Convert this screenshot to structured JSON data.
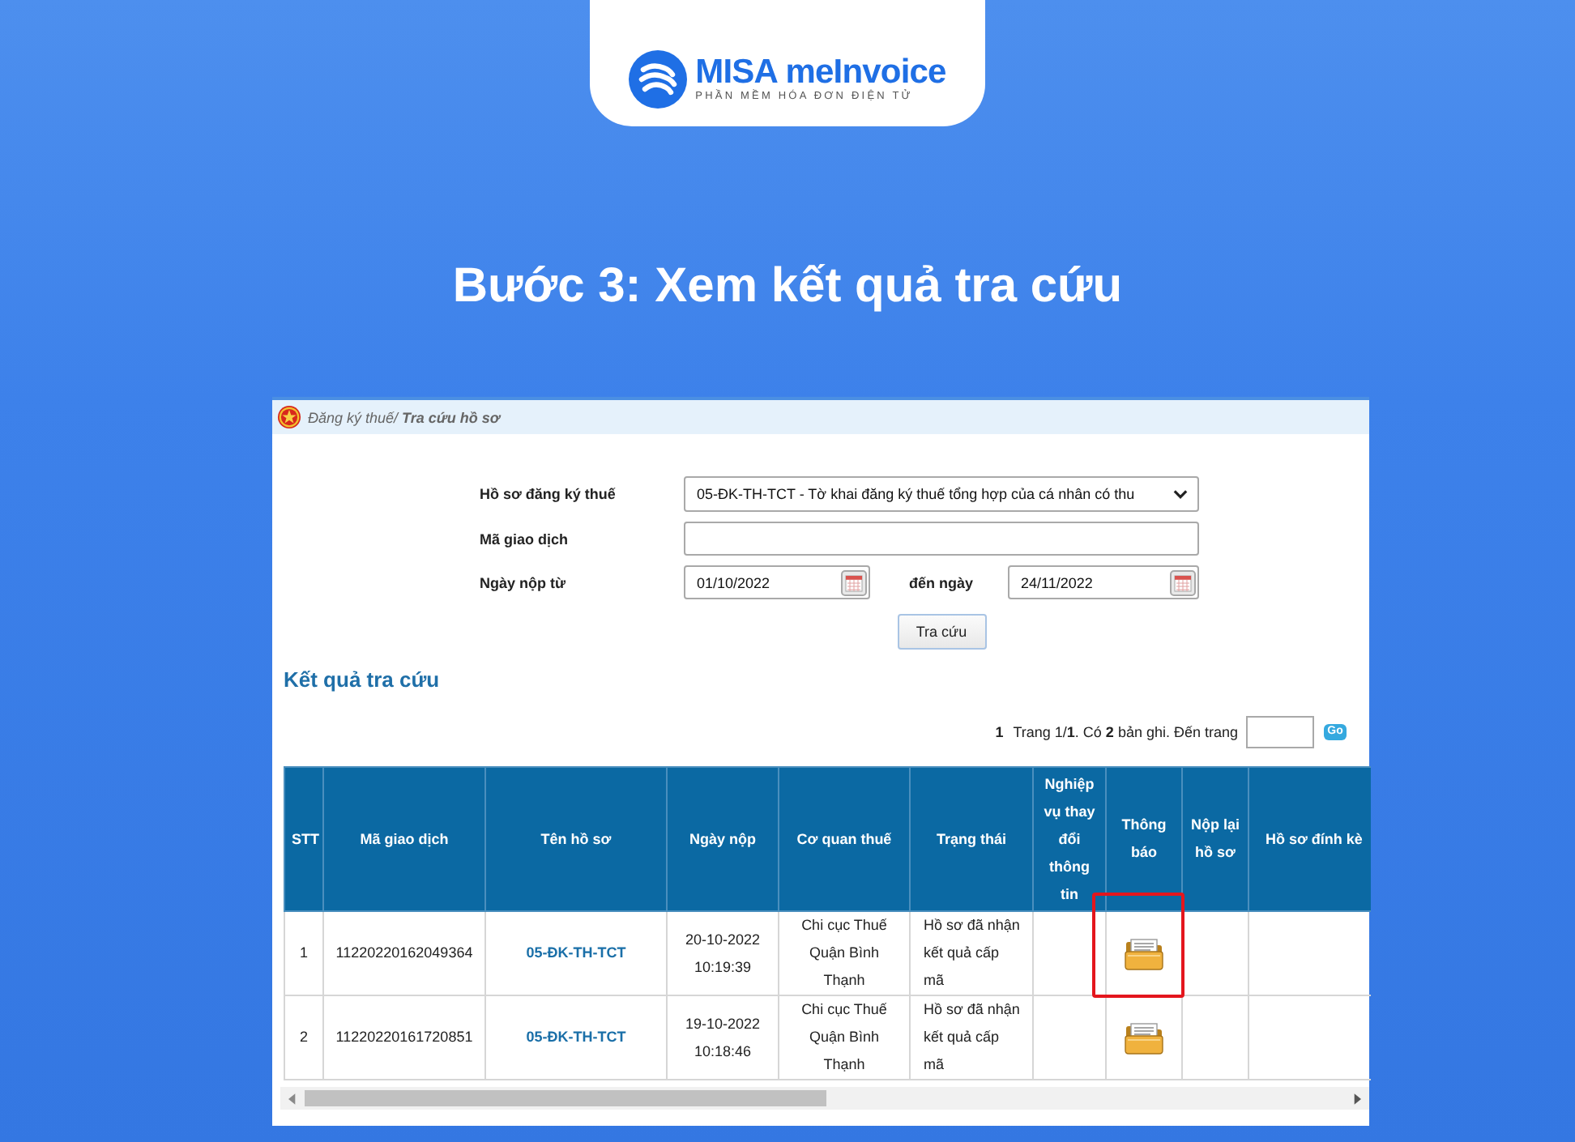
{
  "brand": {
    "name": "MISA meInvoice",
    "tagline": "PHẦN MỀM HÓA ĐƠN ĐIỆN TỬ"
  },
  "heading": "Bước 3: Xem kết quả tra cứu",
  "screenshot": {
    "breadcrumb": "Đăng ký thuế/ **Tra cứu hồ sơ**",
    "form": {
      "fields": [
        {
          "kind": "select",
          "label": "Hồ sơ đăng ký thuế",
          "value": "05-ĐK-TH-TCT - Tờ khai đăng ký thuế tổng hợp của cá nhân có thu"
        },
        {
          "kind": "text",
          "label": "Mã giao dịch"
        },
        {
          "kind": "date_range",
          "label": "Ngày nộp từ",
          "value": "01/10/2022",
          "to_label": "đến ngày",
          "to_value": "24/11/2022"
        }
      ],
      "submit": "Tra cứu"
    },
    "results": {
      "title": "Kết quả tra cứu",
      "pager": {
        "current_page": "1",
        "summary": "Trang 1/**1**. Có **2** bản ghi. Đến trang",
        "go": "Go"
      },
      "table": {
        "columns": [
          "STT",
          "Mã giao dịch",
          "Tên hồ sơ",
          "Ngày nộp",
          "Cơ quan thuế",
          "Trạng thái",
          "Nghiệp vụ thay đổi thông tin",
          "Thông báo",
          "Nộp lại hồ sơ",
          "Hồ sơ đính kè"
        ],
        "rows": [
          {
            "stt": "1",
            "transaction_id": "11220220162049364",
            "form_name": "05-ĐK-TH-TCT",
            "submitted_at": "20-10-2022 10:19:39",
            "tax_office": "Chi cục Thuế Quận Bình Thạnh",
            "status": "Hồ sơ đã nhận kết quả cấp mã",
            "notice": true,
            "highlighted": true
          },
          {
            "stt": "2",
            "transaction_id": "11220220161720851",
            "form_name": "05-ĐK-TH-TCT",
            "submitted_at": "19-10-2022 10:18:46",
            "tax_office": "Chi cục Thuế Quận Bình Thạnh",
            "status": "Hồ sơ đã nhận kết quả cấp mã",
            "notice": true,
            "highlighted": false
          }
        ]
      }
    }
  }
}
